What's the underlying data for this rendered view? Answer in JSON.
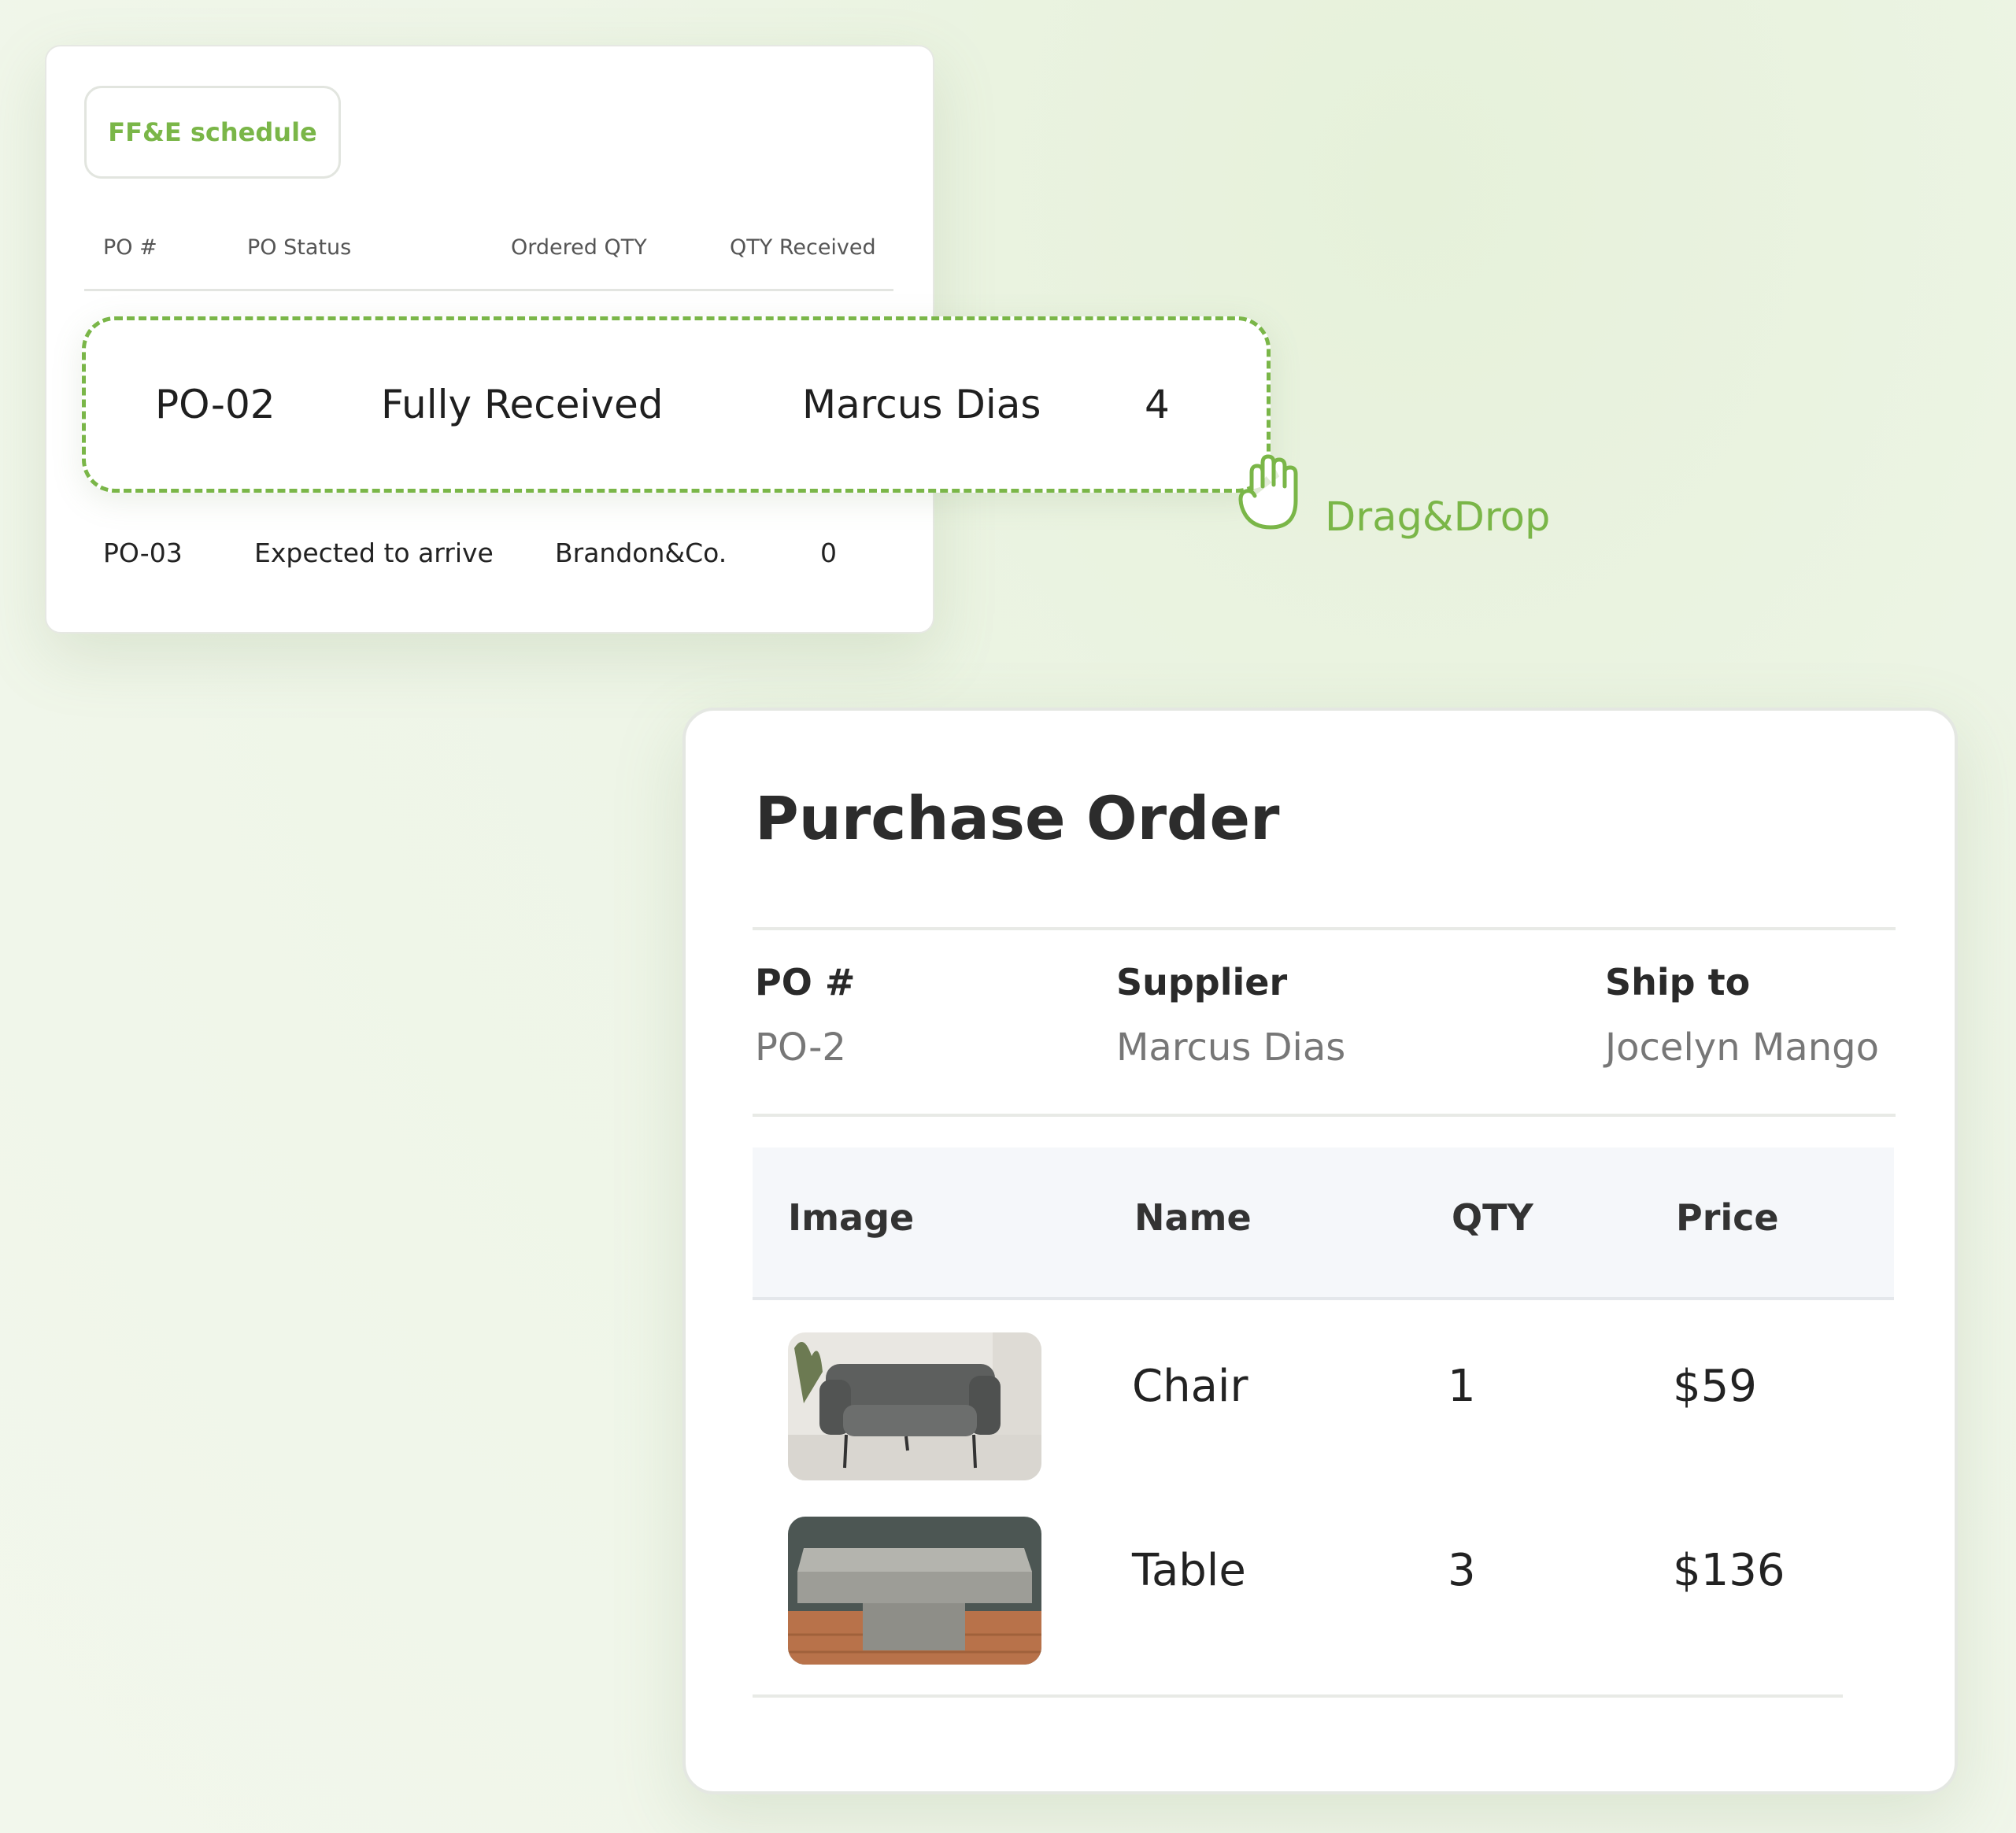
{
  "schedule": {
    "tab_label": "FF&E schedule",
    "columns": [
      "PO #",
      "PO Status",
      "Ordered QTY",
      "QTY Received"
    ],
    "rows": [
      {
        "po": "PO-03",
        "status": "Expected to arrive",
        "supplier": "Brandon&Co.",
        "qty": "0"
      }
    ]
  },
  "dragged_row": {
    "po": "PO-02",
    "status": "Fully Received",
    "supplier": "Marcus Dias",
    "qty": "4"
  },
  "drag_hint": {
    "label": "Drag&Drop",
    "icon": "grab-hand-icon",
    "color": "#7ab648"
  },
  "purchase_order": {
    "title": "Purchase Order",
    "meta": [
      {
        "label": "PO #",
        "value": "PO-2"
      },
      {
        "label": "Supplier",
        "value": "Marcus Dias"
      },
      {
        "label": "Ship to",
        "value": "Jocelyn Mango"
      }
    ],
    "item_columns": [
      "Image",
      "Name",
      "QTY",
      "Price"
    ],
    "items": [
      {
        "name": "Chair",
        "qty": "1",
        "price": "$59",
        "image": "armchair-photo"
      },
      {
        "name": "Table",
        "qty": "3",
        "price": "$136",
        "image": "concrete-table-photo"
      }
    ]
  }
}
